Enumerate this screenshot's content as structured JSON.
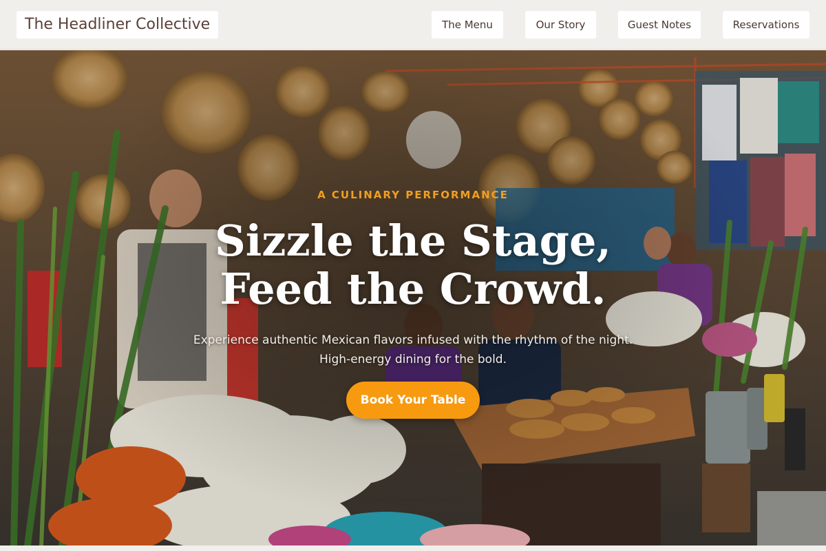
{
  "brand": {
    "name": "The Headliner Collective"
  },
  "nav": {
    "items": [
      {
        "label": "The Menu"
      },
      {
        "label": "Our Story"
      },
      {
        "label": "Guest Notes"
      },
      {
        "label": "Reservations"
      }
    ]
  },
  "hero": {
    "eyebrow": "A CULINARY PERFORMANCE",
    "headline_line1": "Sizzle the Stage,",
    "headline_line2": "Feed the Crowd.",
    "subtitle_line1": "Experience authentic Mexican flavors infused with the rhythm of the night.",
    "subtitle_line2": "High-energy dining for the bold.",
    "cta_label": "Book Your Table",
    "background_description_icon": "market-photo"
  },
  "colors": {
    "accent": "#f79a10",
    "eyebrow": "#f0a020",
    "brand_text": "#5b4038",
    "header_bg": "#f1efeb"
  }
}
